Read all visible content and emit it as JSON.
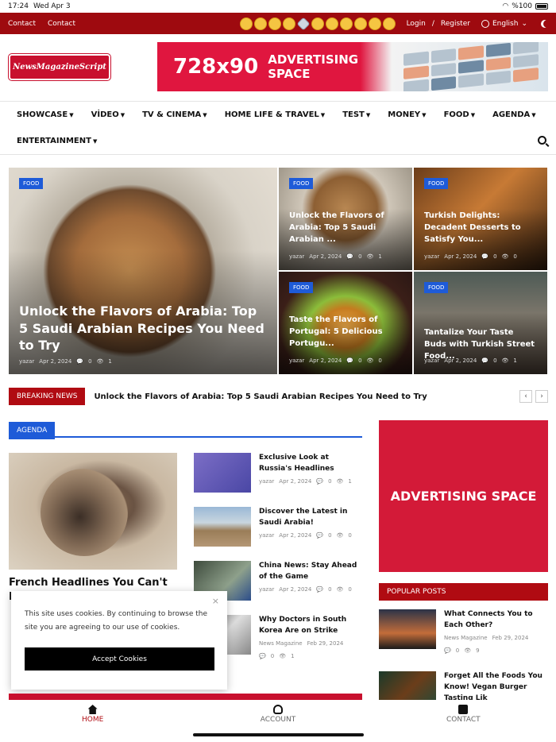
{
  "status": {
    "time": "17:24",
    "date": "Wed Apr 3",
    "battery": "%100"
  },
  "topbar": {
    "links": [
      "Contact",
      "Contact"
    ],
    "login": "Login",
    "separator": "/",
    "register": "Register",
    "language": "English"
  },
  "header": {
    "logo_text": "NewsMagazineScript",
    "ad_big": "728x90",
    "ad_small_line1": "ADVERTISING",
    "ad_small_line2": "SPACE"
  },
  "nav": {
    "items": [
      "SHOWCASE",
      "VİDEO",
      "TV & CINEMA",
      "HOME LIFE & TRAVEL",
      "TEST",
      "MONEY",
      "FOOD",
      "AGENDA",
      "ENTERTAINMENT"
    ]
  },
  "hero": {
    "main": {
      "category": "FOOD",
      "title": "Unlock the Flavors of Arabia: Top 5 Saudi Arabian Recipes You Need to Try",
      "author": "yazar",
      "date": "Apr 2, 2024",
      "comments": "0",
      "views": "1"
    },
    "tiles": [
      {
        "category": "FOOD",
        "title": "Unlock the Flavors of Arabia: Top 5 Saudi Arabian ...",
        "author": "yazar",
        "date": "Apr 2, 2024",
        "comments": "0",
        "views": "1"
      },
      {
        "category": "FOOD",
        "title": "Turkish Delights: Decadent Desserts to Satisfy You...",
        "author": "yazar",
        "date": "Apr 2, 2024",
        "comments": "0",
        "views": "0"
      },
      {
        "category": "FOOD",
        "title": "Taste the Flavors of Portugal: 5 Delicious Portugu...",
        "author": "yazar",
        "date": "Apr 2, 2024",
        "comments": "0",
        "views": "0"
      },
      {
        "category": "FOOD",
        "title": "Tantalize Your Taste Buds with Turkish Street Food...",
        "author": "yazar",
        "date": "Apr 2, 2024",
        "comments": "0",
        "views": "1"
      }
    ]
  },
  "breaking": {
    "label": "BREAKING NEWS",
    "text": "Unlock the Flavors of Arabia: Top 5 Saudi Arabian Recipes You Need to Try",
    "prev": "‹",
    "next": "›"
  },
  "agenda": {
    "tab": "AGENDA",
    "featured_title": "French Headlines You Can't M",
    "items": [
      {
        "title": "Exclusive Look at Russia's Headlines",
        "author": "yazar",
        "date": "Apr 2, 2024",
        "comments": "0",
        "views": "1"
      },
      {
        "title": "Discover the Latest in Saudi Arabia!",
        "author": "yazar",
        "date": "Apr 2, 2024",
        "comments": "0",
        "views": "0"
      },
      {
        "title": "China News: Stay Ahead of the Game",
        "author": "yazar",
        "date": "Apr 2, 2024",
        "comments": "0",
        "views": "0"
      },
      {
        "title": "Why Doctors in South Korea Are on Strike",
        "author": "News Magazine",
        "date": "Feb 29, 2024",
        "comments": "0",
        "views": "1"
      }
    ]
  },
  "sidebar": {
    "ad_text": "ADVERTISING SPACE",
    "popular_title": "POPULAR POSTS",
    "posts": [
      {
        "title": "What Connects You to Each Other?",
        "author": "News Magazine",
        "date": "Feb 29, 2024",
        "comments": "0",
        "views": "9"
      },
      {
        "title": "Forget All the Foods You Know! Vegan Burger Tasting Lik",
        "author": "",
        "date": "",
        "comments": "",
        "views": ""
      }
    ]
  },
  "cookie": {
    "message": "This site uses cookies. By continuing to browse the site you are agreeing to our use of cookies.",
    "button": "Accept Cookies",
    "close": "×"
  },
  "tabbar": {
    "home": "HOME",
    "account": "ACCOUNT",
    "contact": "CONTACT"
  },
  "colors": {
    "brand_red": "#9e0a0f",
    "accent_blue": "#1e5bd8",
    "ad_red": "#d31a38"
  }
}
